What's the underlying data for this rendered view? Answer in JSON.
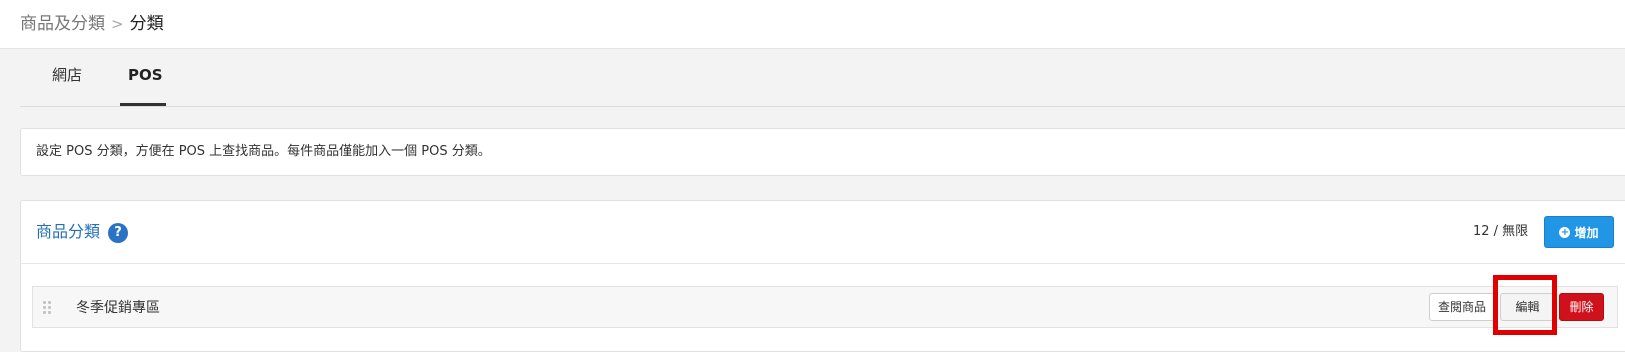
{
  "breadcrumb": {
    "parent": "商品及分類",
    "separator": ">",
    "current": "分類"
  },
  "tabs": [
    {
      "label": "網店",
      "active": false
    },
    {
      "label": "POS",
      "active": true
    }
  ],
  "info": {
    "text": "設定 POS 分類，方便在 POS 上查找商品。每件商品僅能加入一個 POS 分類。"
  },
  "panel": {
    "title": "商品分類",
    "help_icon": "question-circle-icon",
    "quota": "12 / 無限",
    "add_button": "增加"
  },
  "categories": [
    {
      "name": "冬季促銷專區",
      "view_label": "查閱商品",
      "edit_label": "編輯",
      "delete_label": "刪除"
    }
  ],
  "colors": {
    "accent": "#2196e6",
    "title_blue": "#2470b8",
    "danger": "#d0111b",
    "highlight": "#e00000"
  }
}
